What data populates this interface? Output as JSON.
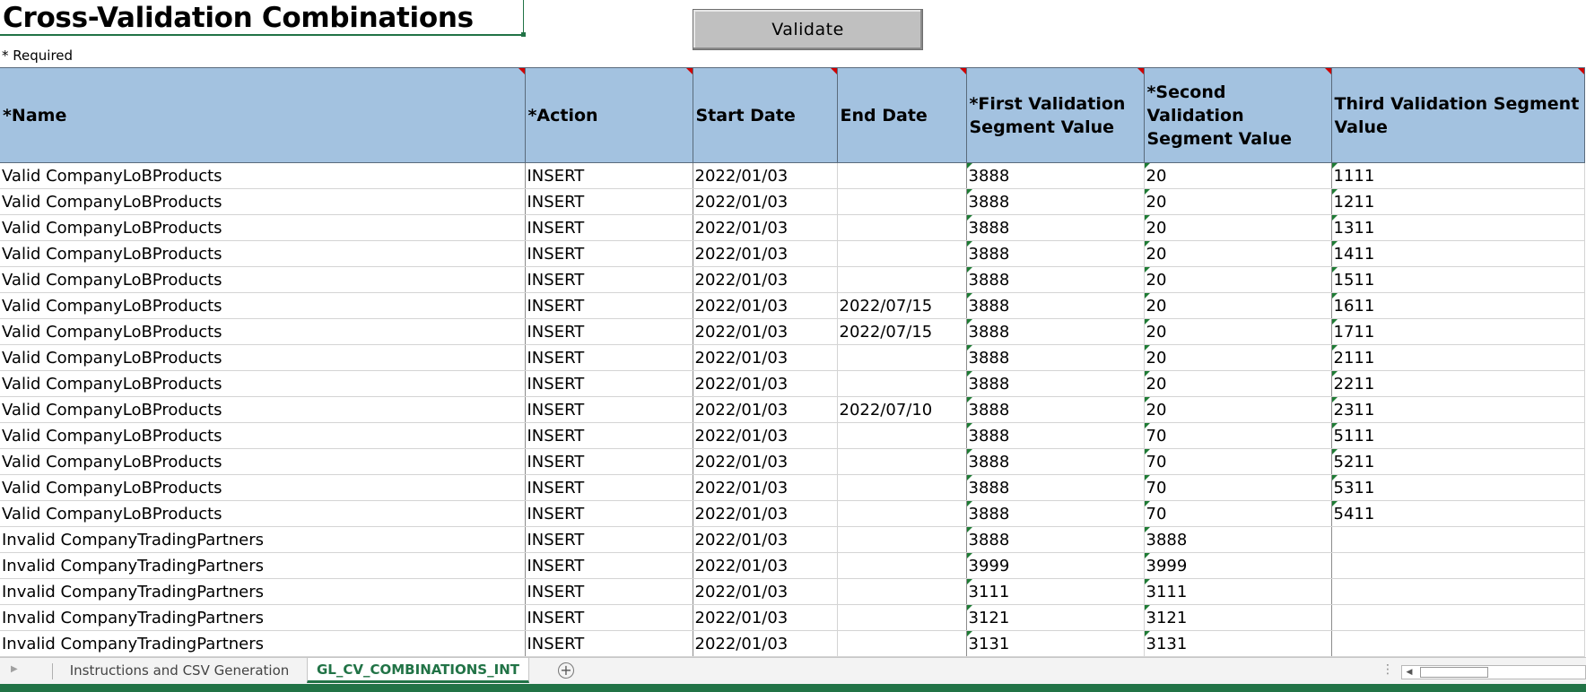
{
  "header": {
    "title": "Cross-Validation Combinations",
    "required_note": "* Required",
    "validate_label": "Validate"
  },
  "columns": [
    "*Name",
    "*Action",
    "Start Date",
    "End Date",
    "*First Validation Segment Value",
    "*Second Validation Segment Value",
    "Third Validation Segment Value"
  ],
  "rows": [
    [
      "Valid CompanyLoBProducts",
      "INSERT",
      "2022/01/03",
      "",
      "3888",
      "20",
      "1111"
    ],
    [
      "Valid CompanyLoBProducts",
      "INSERT",
      "2022/01/03",
      "",
      "3888",
      "20",
      "1211"
    ],
    [
      "Valid CompanyLoBProducts",
      "INSERT",
      "2022/01/03",
      "",
      "3888",
      "20",
      "1311"
    ],
    [
      "Valid CompanyLoBProducts",
      "INSERT",
      "2022/01/03",
      "",
      "3888",
      "20",
      "1411"
    ],
    [
      "Valid CompanyLoBProducts",
      "INSERT",
      "2022/01/03",
      "",
      "3888",
      "20",
      "1511"
    ],
    [
      "Valid CompanyLoBProducts",
      "INSERT",
      "2022/01/03",
      "2022/07/15",
      "3888",
      "20",
      "1611"
    ],
    [
      "Valid CompanyLoBProducts",
      "INSERT",
      "2022/01/03",
      "2022/07/15",
      "3888",
      "20",
      "1711"
    ],
    [
      "Valid CompanyLoBProducts",
      "INSERT",
      "2022/01/03",
      "",
      "3888",
      "20",
      "2111"
    ],
    [
      "Valid CompanyLoBProducts",
      "INSERT",
      "2022/01/03",
      "",
      "3888",
      "20",
      "2211"
    ],
    [
      "Valid CompanyLoBProducts",
      "INSERT",
      "2022/01/03",
      "2022/07/10",
      "3888",
      "20",
      "2311"
    ],
    [
      "Valid CompanyLoBProducts",
      "INSERT",
      "2022/01/03",
      "",
      "3888",
      "70",
      "5111"
    ],
    [
      "Valid CompanyLoBProducts",
      "INSERT",
      "2022/01/03",
      "",
      "3888",
      "70",
      "5211"
    ],
    [
      "Valid CompanyLoBProducts",
      "INSERT",
      "2022/01/03",
      "",
      "3888",
      "70",
      "5311"
    ],
    [
      "Valid CompanyLoBProducts",
      "INSERT",
      "2022/01/03",
      "",
      "3888",
      "70",
      "5411"
    ],
    [
      "Invalid CompanyTradingPartners",
      "INSERT",
      "2022/01/03",
      "",
      "3888",
      "3888",
      ""
    ],
    [
      "Invalid CompanyTradingPartners",
      "INSERT",
      "2022/01/03",
      "",
      "3999",
      "3999",
      ""
    ],
    [
      "Invalid CompanyTradingPartners",
      "INSERT",
      "2022/01/03",
      "",
      "3111",
      "3111",
      ""
    ],
    [
      "Invalid CompanyTradingPartners",
      "INSERT",
      "2022/01/03",
      "",
      "3121",
      "3121",
      ""
    ],
    [
      "Invalid CompanyTradingPartners",
      "INSERT",
      "2022/01/03",
      "",
      "3131",
      "3131",
      ""
    ]
  ],
  "tabs": {
    "instructions": "Instructions and CSV Generation",
    "active": "GL_CV_COMBINATIONS_INT"
  },
  "icons": {
    "add_sheet": "plus-circle-icon",
    "scroll_left": "triangle-left-icon"
  },
  "colors": {
    "header_fill": "#a3c2e0",
    "accent": "#217346",
    "comment_flag": "#d00000"
  }
}
